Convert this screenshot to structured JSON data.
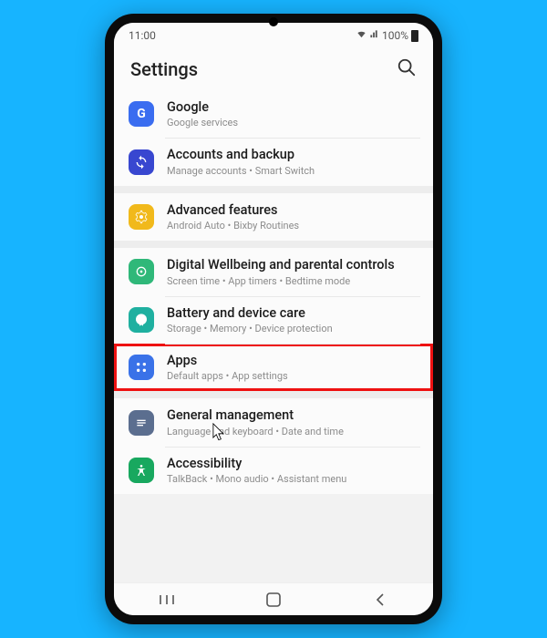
{
  "status": {
    "time": "11:00",
    "battery": "100%"
  },
  "header": {
    "title": "Settings"
  },
  "items": [
    {
      "key": "google",
      "title": "Google",
      "sub": "Google services"
    },
    {
      "key": "accounts",
      "title": "Accounts and backup",
      "sub": "Manage accounts  •  Smart Switch"
    },
    {
      "key": "advanced",
      "title": "Advanced features",
      "sub": "Android Auto  •  Bixby Routines"
    },
    {
      "key": "wellbeing",
      "title": "Digital Wellbeing and parental controls",
      "sub": "Screen time  •  App timers  •  Bedtime mode"
    },
    {
      "key": "battery",
      "title": "Battery and device care",
      "sub": "Storage  •  Memory  •  Device protection"
    },
    {
      "key": "apps",
      "title": "Apps",
      "sub": "Default apps  •  App settings"
    },
    {
      "key": "general",
      "title": "General management",
      "sub": "Language and keyboard  •  Date and time"
    },
    {
      "key": "access",
      "title": "Accessibility",
      "sub": "TalkBack  •  Mono audio  •  Assistant menu"
    }
  ],
  "highlighted": "apps"
}
